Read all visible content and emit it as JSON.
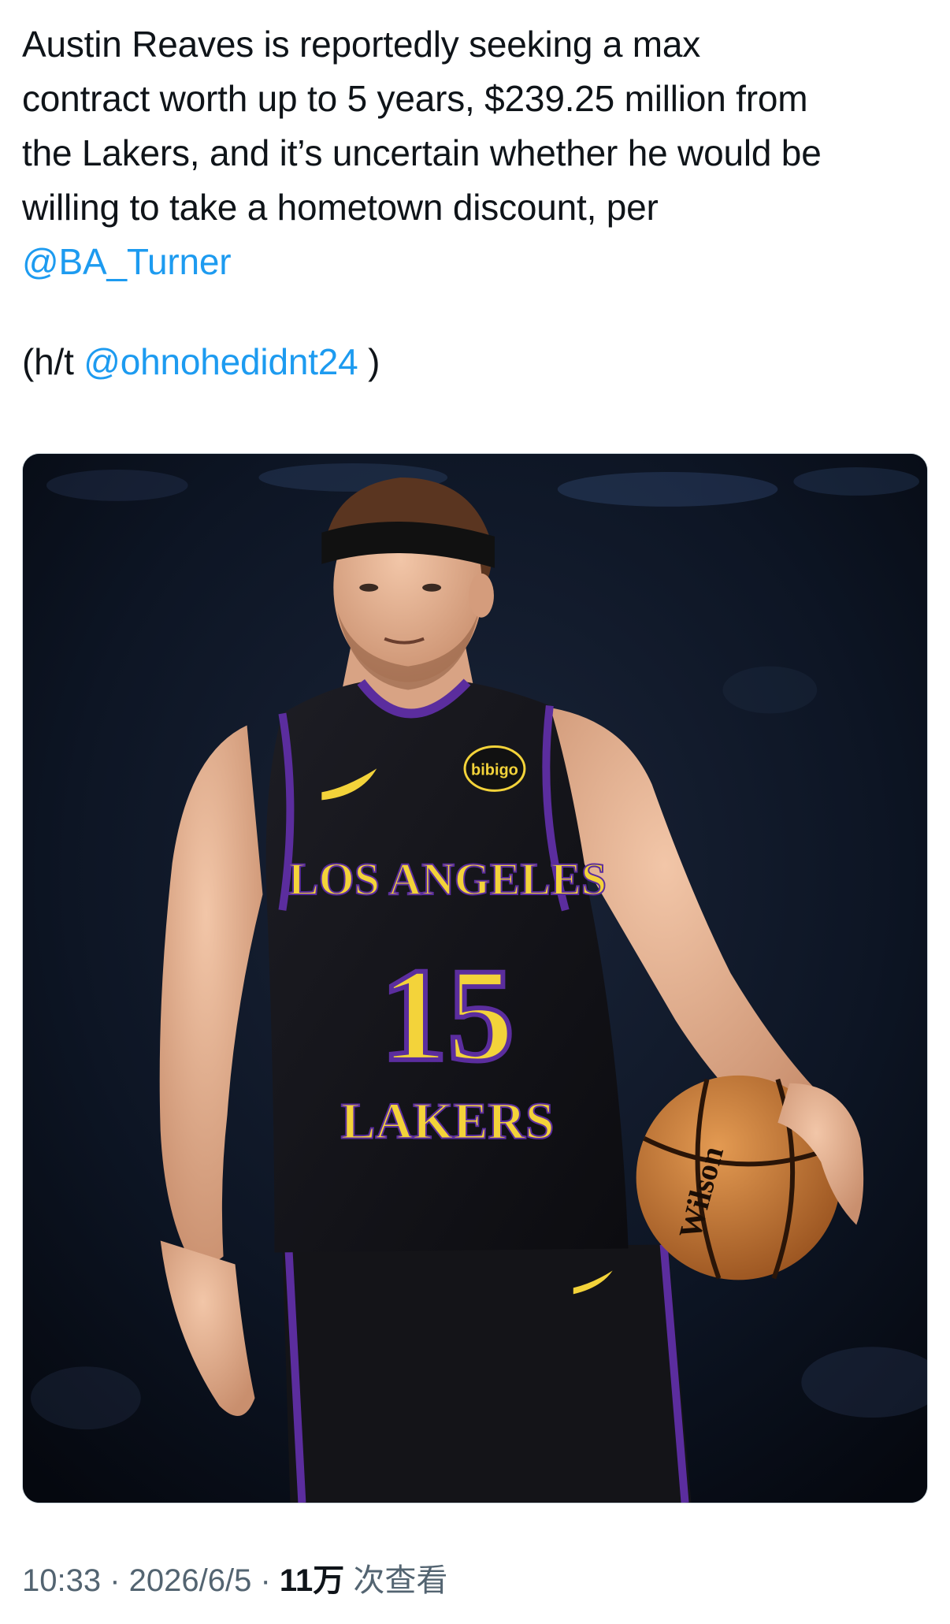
{
  "tweet": {
    "lines": [
      "Austin Reaves is reportedly seeking a max",
      "contract worth up to 5 years, $239.25 million from",
      "the Lakers, and it’s uncertain whether he would be",
      "willing to take a hometown discount, per"
    ],
    "mention_primary": "@BA_Turner",
    "ht_prefix": "(h/t ",
    "mention_secondary": "@ohnohedidnt24",
    "ht_suffix": " )"
  },
  "media": {
    "jersey_text_top": "LOS ANGELES",
    "jersey_number": "15",
    "jersey_text_bottom": "LAKERS",
    "sponsor_patch": "bibigo",
    "ball_brand": "Wilson",
    "colors": {
      "jersey": "#14141a",
      "trim_purple": "#5b2d9e",
      "gold": "#f3d33a",
      "ball": "#c9762f",
      "background": "#0b1220"
    }
  },
  "meta": {
    "time": "10:33",
    "separator": " · ",
    "date": "2026/6/5",
    "views_count": "11万",
    "views_label": " 次查看"
  }
}
